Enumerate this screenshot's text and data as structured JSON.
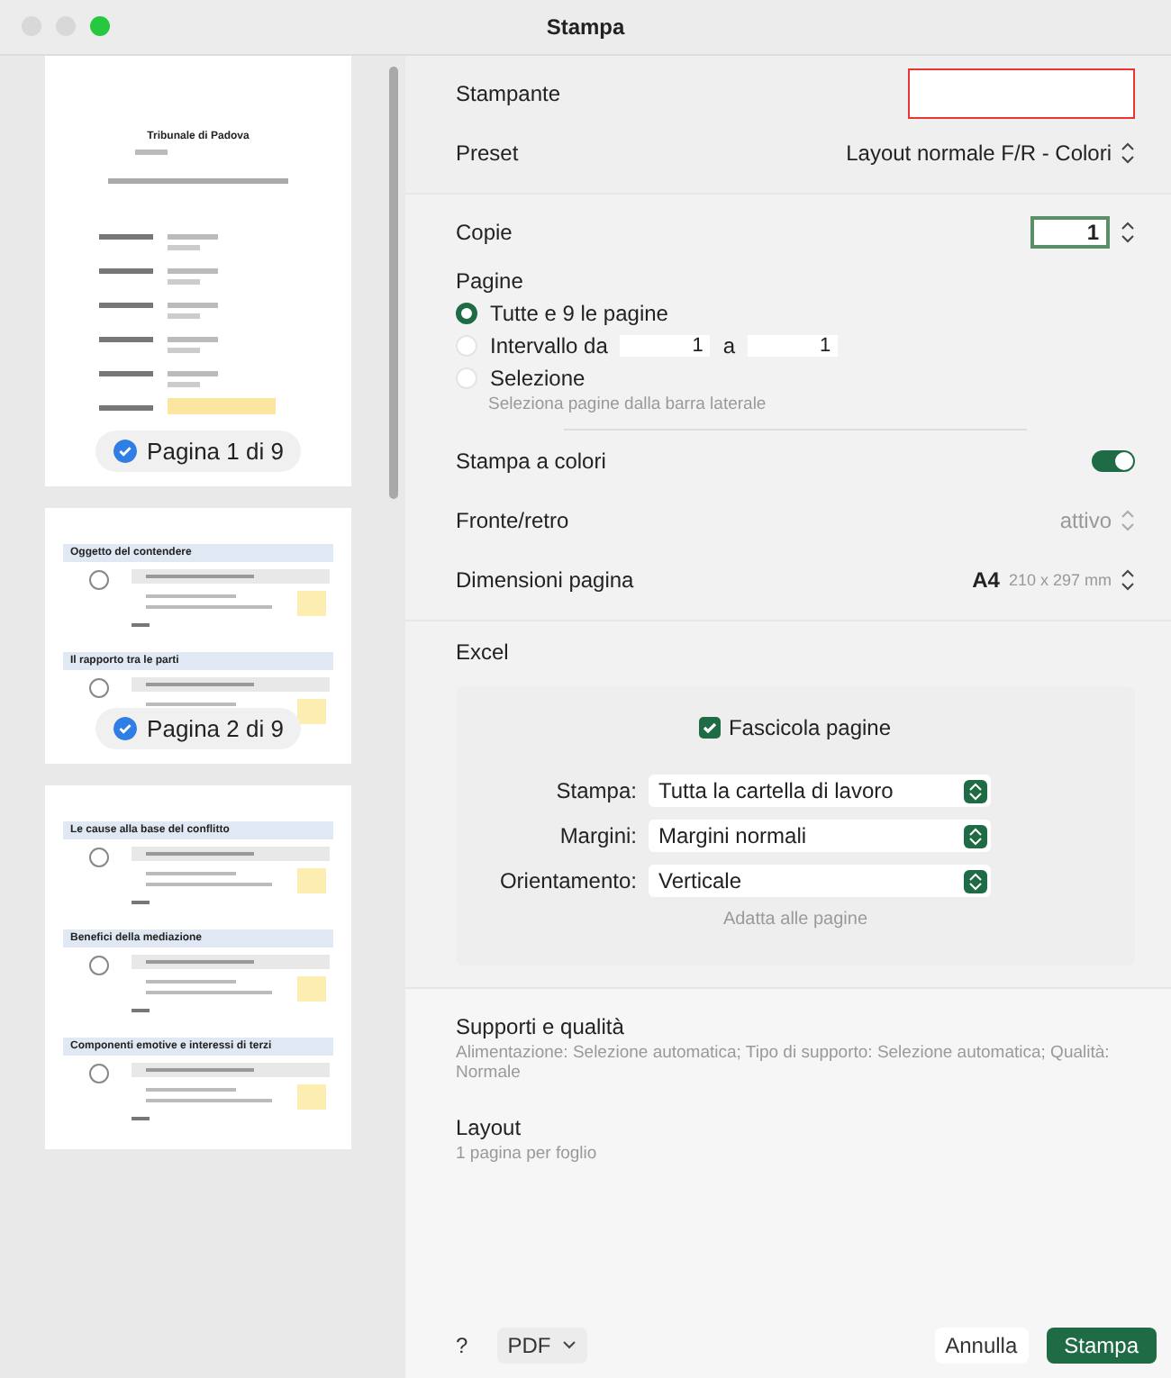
{
  "window": {
    "title": "Stampa"
  },
  "thumbnails": [
    {
      "label": "Pagina 1 di 9",
      "selected": true,
      "title": "Tribunale di Padova"
    },
    {
      "label": "Pagina 2 di 9",
      "selected": true,
      "sections": [
        "Oggetto del contendere",
        "Il rapporto tra le parti"
      ]
    },
    {
      "sections": [
        "Le cause alla base del conflitto",
        "Benefici della mediazione",
        "Componenti emotive e interessi di terzi"
      ]
    }
  ],
  "printer": {
    "label": "Stampante"
  },
  "preset": {
    "label": "Preset",
    "value": "Layout normale F/R - Colori"
  },
  "copies": {
    "label": "Copie",
    "value": "1"
  },
  "pages": {
    "label": "Pagine",
    "options": [
      {
        "kind": "all",
        "label": "Tutte e 9 le pagine",
        "selected": true
      },
      {
        "kind": "range",
        "label": "Intervallo da",
        "from": "1",
        "to_label": "a",
        "to": "1",
        "selected": false
      },
      {
        "kind": "selection",
        "label": "Selezione",
        "hint": "Seleziona pagine dalla barra laterale",
        "selected": false
      }
    ]
  },
  "color_print": {
    "label": "Stampa a colori",
    "on": true
  },
  "duplex": {
    "label": "Fronte/retro",
    "value": "attivo",
    "disabled": true
  },
  "paper_size": {
    "label": "Dimensioni pagina",
    "value": "A4",
    "detail": "210 x 297 mm"
  },
  "excel": {
    "title": "Excel",
    "collate": {
      "label": "Fascicola pagine",
      "checked": true
    },
    "selects": [
      {
        "label": "Stampa:",
        "value": "Tutta la cartella di lavoro"
      },
      {
        "label": "Margini:",
        "value": "Margini normali"
      },
      {
        "label": "Orientamento:",
        "value": "Verticale"
      }
    ],
    "fit": {
      "label": "Adatta alle pagine",
      "disabled": true
    }
  },
  "sections": [
    {
      "title": "Supporti e qualità",
      "summary": "Alimentazione: Selezione automatica; Tipo di supporto: Selezione automatica; Qualità: Normale"
    },
    {
      "title": "Layout",
      "summary": "1 pagina per foglio"
    }
  ],
  "footer": {
    "help": "?",
    "pdf": "PDF",
    "cancel": "Annulla",
    "print": "Stampa"
  }
}
